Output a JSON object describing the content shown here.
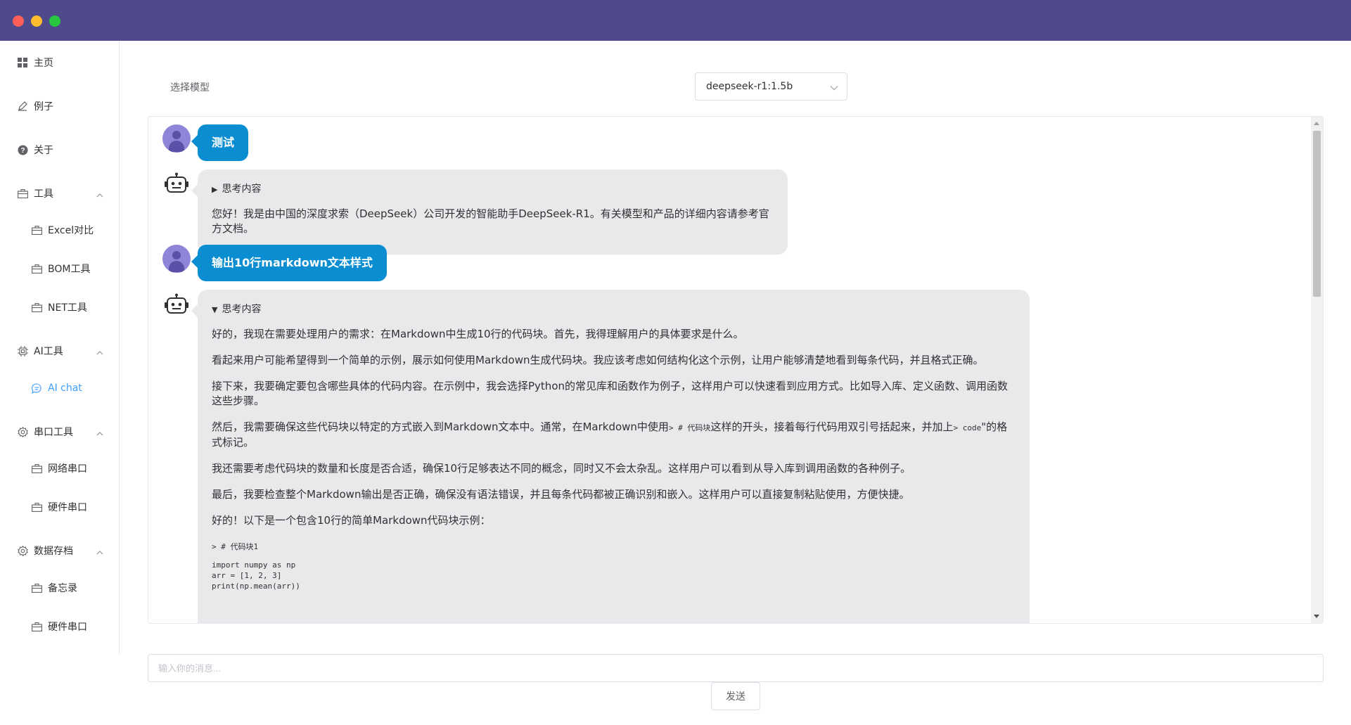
{
  "sidebar": {
    "items": [
      {
        "label": "主页",
        "icon": "grid-icon"
      },
      {
        "label": "例子",
        "icon": "edit-icon"
      },
      {
        "label": "关于",
        "icon": "help-circle-icon"
      },
      {
        "label": "工具",
        "icon": "briefcase-icon",
        "expanded": true
      },
      {
        "label": "Excel对比",
        "icon": "briefcase-icon"
      },
      {
        "label": "BOM工具",
        "icon": "briefcase-icon"
      },
      {
        "label": "NET工具",
        "icon": "briefcase-icon"
      },
      {
        "label": "AI工具",
        "icon": "cpu-icon",
        "expanded": true
      },
      {
        "label": "AI chat",
        "icon": "chat-icon",
        "active": true
      },
      {
        "label": "串口工具",
        "icon": "settings-icon",
        "expanded": true
      },
      {
        "label": "网络串口",
        "icon": "briefcase-icon"
      },
      {
        "label": "硬件串口",
        "icon": "briefcase-icon"
      },
      {
        "label": "数据存档",
        "icon": "settings-icon",
        "expanded": true
      },
      {
        "label": "备忘录",
        "icon": "briefcase-icon"
      },
      {
        "label": "硬件串口",
        "icon": "briefcase-icon"
      }
    ]
  },
  "model": {
    "label": "选择模型",
    "selected": "deepseek-r1:1.5b"
  },
  "chat": {
    "messages": [
      {
        "role": "user",
        "text": "测试"
      },
      {
        "role": "assistant",
        "think_label": "思考内容",
        "think_expanded": false,
        "text": "您好！我是由中国的深度求索（DeepSeek）公司开发的智能助手DeepSeek-R1。有关模型和产品的详细内容请参考官方文档。"
      },
      {
        "role": "user",
        "text": "输出10行markdown文本样式"
      },
      {
        "role": "assistant",
        "think_label": "思考内容",
        "think_expanded": true,
        "paragraphs": [
          "好的，我现在需要处理用户的需求：在Markdown中生成10行的代码块。首先，我得理解用户的具体要求是什么。",
          "看起来用户可能希望得到一个简单的示例，展示如何使用Markdown生成代码块。我应该考虑如何结构化这个示例，让用户能够清楚地看到每条代码，并且格式正确。",
          "接下来，我要确定要包含哪些具体的代码内容。在示例中，我会选择Python的常见库和函数作为例子，这样用户可以快速看到应用方式。比如导入库、定义函数、调用函数这些步骤。",
          "我还需要考虑代码块的数量和长度是否合适，确保10行足够表达不同的概念，同时又不会太杂乱。这样用户可以看到从导入库到调用函数的各种例子。",
          "最后，我要检查整个Markdown输出是否正确，确保没有语法错误，并且每条代码都被正确识别和嵌入。这样用户可以直接复制粘贴使用，方便快捷。",
          "好的！以下是一个包含10行的简单Markdown代码块示例："
        ],
        "p4": {
          "before": "然后，我需要确保这些代码块以特定的方式嵌入到Markdown文本中。通常，在Markdown中使用",
          "mono1": "> # 代码块",
          "middle": "这样的开头，接着每行代码用双引号括起来，并加上",
          "mono2": "> code",
          "after": "\"的格式标记。"
        },
        "code_heading": "> # 代码块1",
        "code": "import numpy as np\narr = [1, 2, 3]\nprint(np.mean(arr))"
      }
    ]
  },
  "input": {
    "placeholder": "输入你的消息..."
  },
  "send": {
    "label": "发送"
  }
}
